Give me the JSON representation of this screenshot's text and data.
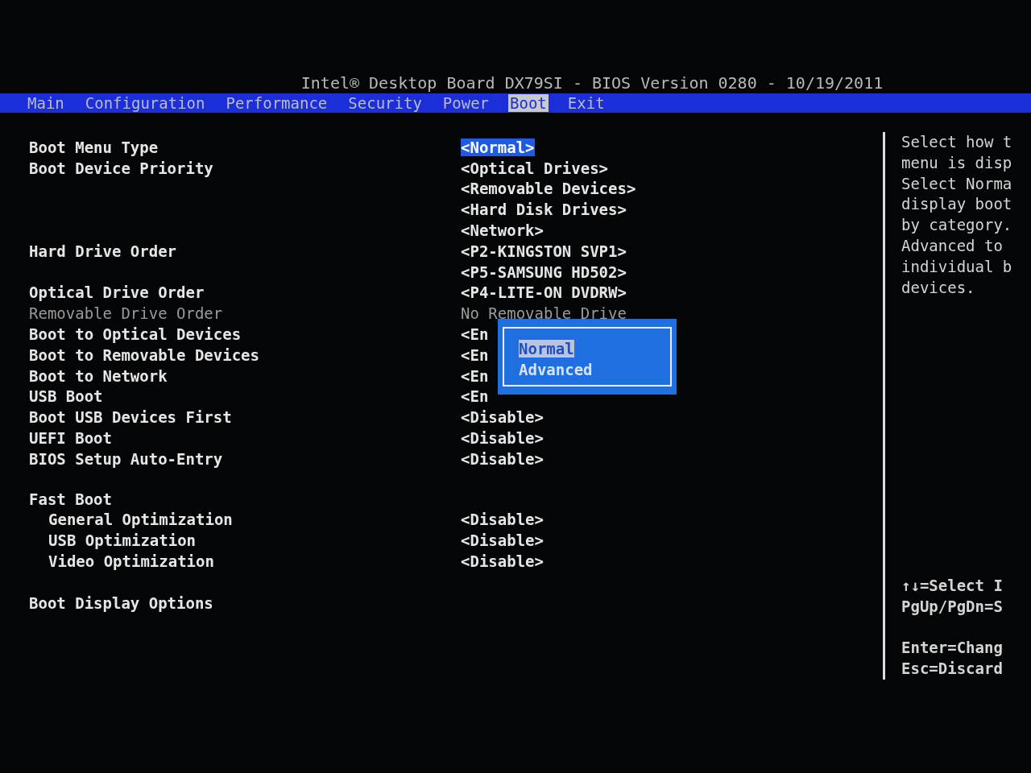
{
  "title": "Intel® Desktop Board DX79SI - BIOS Version 0280 - 10/19/2011",
  "tabs": [
    {
      "label": "Main",
      "selected": false
    },
    {
      "label": "Configuration",
      "selected": false
    },
    {
      "label": "Performance",
      "selected": false
    },
    {
      "label": "Security",
      "selected": false
    },
    {
      "label": "Power",
      "selected": false
    },
    {
      "label": "Boot",
      "selected": true
    },
    {
      "label": "Exit",
      "selected": false
    }
  ],
  "settings": [
    {
      "kind": "setting",
      "label": "Boot Menu Type",
      "disabled": false,
      "values": [
        {
          "text": "<Normal>",
          "selected": true
        }
      ]
    },
    {
      "kind": "setting",
      "label": "Boot Device Priority",
      "disabled": false,
      "values": [
        {
          "text": "<Optical Drives>",
          "selected": false
        },
        {
          "text": "<Removable Devices>",
          "selected": false
        },
        {
          "text": "<Hard Disk Drives>",
          "selected": false
        },
        {
          "text": "<Network>",
          "selected": false
        }
      ]
    },
    {
      "kind": "setting",
      "label": "Hard Drive Order",
      "disabled": false,
      "values": [
        {
          "text": "<P2-KINGSTON SVP1>",
          "selected": false
        },
        {
          "text": "<P5-SAMSUNG HD502>",
          "selected": false
        }
      ]
    },
    {
      "kind": "setting",
      "label": "Optical Drive Order",
      "disabled": false,
      "values": [
        {
          "text": "<P4-LITE-ON DVDRW>",
          "selected": false
        }
      ]
    },
    {
      "kind": "setting",
      "label": "Removable Drive Order",
      "disabled": true,
      "values": [
        {
          "text": "No Removable Drive",
          "selected": false
        }
      ]
    },
    {
      "kind": "setting",
      "label": "Boot to Optical Devices",
      "disabled": false,
      "values": [
        {
          "text": "<En",
          "selected": false
        }
      ]
    },
    {
      "kind": "setting",
      "label": "Boot to Removable Devices",
      "disabled": false,
      "values": [
        {
          "text": "<En",
          "selected": false
        }
      ]
    },
    {
      "kind": "setting",
      "label": "Boot to Network",
      "disabled": false,
      "values": [
        {
          "text": "<En",
          "selected": false
        }
      ]
    },
    {
      "kind": "setting",
      "label": "USB Boot",
      "disabled": false,
      "values": [
        {
          "text": "<En",
          "selected": false
        }
      ]
    },
    {
      "kind": "setting",
      "label": "Boot USB Devices First",
      "disabled": false,
      "values": [
        {
          "text": "<Disable>",
          "selected": false
        }
      ]
    },
    {
      "kind": "setting",
      "label": "UEFI Boot",
      "disabled": false,
      "values": [
        {
          "text": "<Disable>",
          "selected": false
        }
      ]
    },
    {
      "kind": "setting",
      "label": "BIOS Setup Auto-Entry",
      "disabled": false,
      "values": [
        {
          "text": "<Disable>",
          "selected": false
        }
      ]
    },
    {
      "kind": "group",
      "label": "Fast Boot",
      "children": [
        {
          "label": "General Optimization",
          "disabled": false,
          "values": [
            {
              "text": "<Disable>",
              "selected": false
            }
          ]
        },
        {
          "label": "USB Optimization",
          "disabled": false,
          "values": [
            {
              "text": "<Disable>",
              "selected": false
            }
          ]
        },
        {
          "label": "Video Optimization",
          "disabled": false,
          "values": [
            {
              "text": "<Disable>",
              "selected": false
            }
          ]
        }
      ]
    },
    {
      "kind": "setting",
      "label": "Boot Display Options",
      "disabled": false
    }
  ],
  "popup": {
    "options": [
      {
        "label": "Normal",
        "selected": true
      },
      {
        "label": "Advanced",
        "selected": false
      }
    ]
  },
  "help": {
    "lines": [
      "Select how t",
      "menu is disp",
      "Select Norma",
      "display boot",
      "by category.",
      "Advanced to",
      "individual b",
      "devices."
    ],
    "keys": [
      [
        "↑↓=Select I",
        "PgUp/PgDn=S"
      ],
      [
        "Enter=Chang",
        "Esc=Discard"
      ]
    ]
  }
}
